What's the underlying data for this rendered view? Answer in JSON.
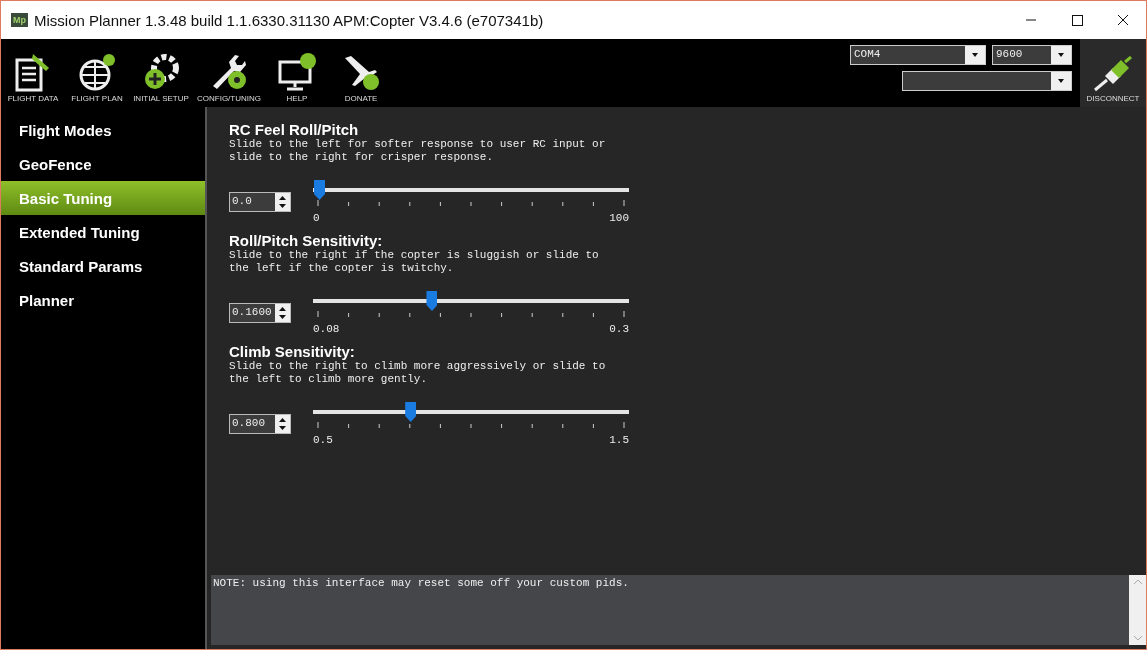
{
  "window": {
    "title": "Mission Planner 1.3.48 build 1.1.6330.31130 APM:Copter V3.4.6 (e707341b)",
    "logo": "Mp"
  },
  "toolbar": [
    {
      "label": "FLIGHT DATA",
      "kind": "data"
    },
    {
      "label": "FLIGHT PLAN",
      "kind": "plan"
    },
    {
      "label": "INITIAL SETUP",
      "kind": "setup"
    },
    {
      "label": "CONFIG/TUNING",
      "kind": "config"
    },
    {
      "label": "HELP",
      "kind": "help"
    },
    {
      "label": "DONATE",
      "kind": "donate"
    }
  ],
  "connection": {
    "port": "COM4",
    "baud": "9600",
    "disconnect": "DISCONNECT"
  },
  "sidebar": {
    "items": [
      {
        "label": "Flight Modes",
        "selected": false
      },
      {
        "label": "GeoFence",
        "selected": false
      },
      {
        "label": "Basic Tuning",
        "selected": true
      },
      {
        "label": "Extended Tuning",
        "selected": false
      },
      {
        "label": "Standard Params",
        "selected": false
      },
      {
        "label": "Planner",
        "selected": false
      }
    ]
  },
  "params": [
    {
      "title": "RC Feel Roll/Pitch",
      "description": "Slide to the left for softer response to user RC input or\nslide to the right for crisper response.",
      "value": "0.0",
      "level": 0,
      "min": "0",
      "max": "100"
    },
    {
      "title": "Roll/Pitch Sensitivity:",
      "description": "Slide to the right if the copter is sluggish or slide to\nthe left if the copter is twitchy.",
      "value": "0.1600",
      "level": 0.37,
      "min": "0.08",
      "max": "0.3"
    },
    {
      "title": "Climb Sensitivity:",
      "description": "Slide to the right to climb more aggressively or slide to\nthe left to climb more gently.",
      "value": "0.800",
      "level": 0.3,
      "min": "0.5",
      "max": "1.5"
    }
  ],
  "note": "NOTE: using this interface may reset some off your custom pids."
}
